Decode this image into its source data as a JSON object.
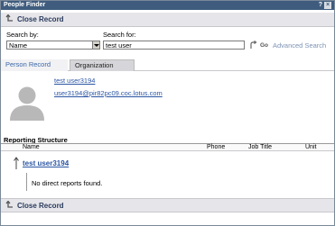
{
  "window": {
    "title": "People Finder",
    "help_label": "?",
    "close_label": "×"
  },
  "close_record": {
    "label": "Close Record"
  },
  "search": {
    "by_label": "Search by:",
    "by_value": "Name",
    "for_label": "Search for:",
    "for_value": "test user",
    "go_label": "Go",
    "advanced_label": "Advanced Search"
  },
  "tabs": [
    {
      "label": "Person Record",
      "active": true
    },
    {
      "label": "Organization",
      "active": false
    }
  ],
  "person": {
    "name": "test user3194",
    "email": "user3194@pir82pc09.coc.lotus.com"
  },
  "reporting": {
    "title": "Reporting Structure",
    "columns": [
      "Name",
      "Phone",
      "Job Title",
      "Unit"
    ],
    "manager": "test user3194",
    "no_reports": "No direct reports found."
  },
  "icons": {
    "back": "back-arrow-icon",
    "go": "go-arrow-icon",
    "avatar": "person-silhouette-icon",
    "up": "up-arrow-icon"
  },
  "colors": {
    "titlebar": "#3f5c7e",
    "link": "#2a55a4",
    "toolbar": "#e6e6ea"
  }
}
